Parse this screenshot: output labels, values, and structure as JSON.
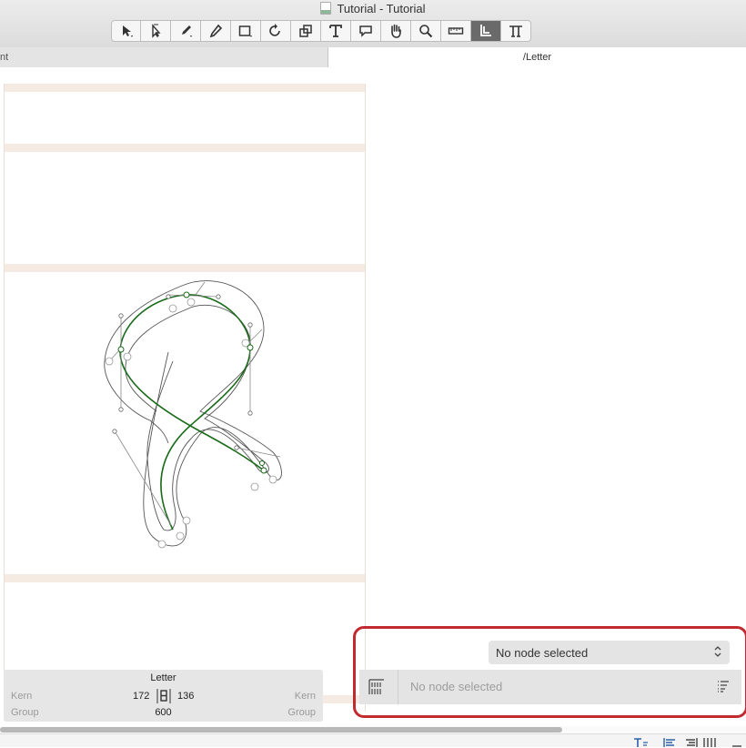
{
  "window": {
    "title": "Tutorial - Tutorial"
  },
  "toolbar": {
    "tools": [
      {
        "icon": "select-arrow-icon"
      },
      {
        "icon": "select-all-layers-icon"
      },
      {
        "icon": "pen-icon"
      },
      {
        "icon": "pencil-icon"
      },
      {
        "icon": "rectangle-icon"
      },
      {
        "icon": "rotate-icon"
      },
      {
        "icon": "scale-icon"
      },
      {
        "icon": "text-icon"
      },
      {
        "icon": "annotation-icon"
      },
      {
        "icon": "hand-icon"
      },
      {
        "icon": "zoom-icon"
      },
      {
        "icon": "measurement-icon"
      },
      {
        "icon": "metrics-icon",
        "active": true
      },
      {
        "icon": "text-tool-icon"
      }
    ]
  },
  "tabs": {
    "left": "nt",
    "right": "/Letter"
  },
  "glyph_info": {
    "name": "Letter",
    "kern_left_label": "Kern",
    "kern_right_label": "Kern",
    "group_left_label": "Group",
    "group_right_label": "Group",
    "lsb": "172",
    "rsb": "136",
    "width": "600"
  },
  "node_panel": {
    "select_value": "No node selected",
    "palette_text": "No node selected"
  },
  "colors": {
    "highlight": "#c12a2f",
    "path_green": "#1a6b1a",
    "band": "#f5ebe3"
  }
}
